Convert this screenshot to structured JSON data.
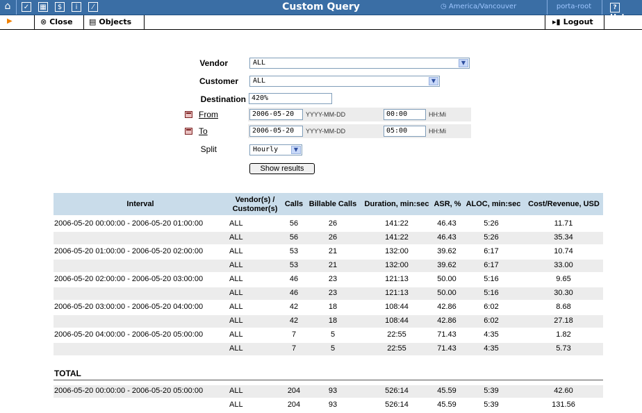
{
  "header": {
    "title": "Custom Query",
    "timezone": "America/Vancouver",
    "user": "porta-root",
    "help_label": "Help",
    "help_icon_glyph": "?",
    "icons": [
      "home-icon",
      "tasks-icon",
      "calculator-icon",
      "billing-icon",
      "info-icon",
      "stats-icon"
    ],
    "icon_glyphs": [
      "⌂",
      "✓",
      "▦",
      "$",
      "i",
      "⁄"
    ]
  },
  "toolbar": {
    "close_label": "Close",
    "objects_label": "Objects",
    "logout_label": "Logout"
  },
  "form": {
    "vendor_label": "Vendor",
    "vendor_value": "ALL",
    "customer_label": "Customer",
    "customer_value": "ALL",
    "destination_label": "Destination",
    "destination_value": "420%",
    "from_label": "From",
    "from_date": "2006-05-20",
    "from_time": "00:00",
    "to_label": "To",
    "to_date": "2006-05-20",
    "to_time": "05:00",
    "date_hint": "YYYY-MM-DD",
    "time_hint": "HH:Mi",
    "split_label": "Split",
    "split_value": "Hourly",
    "show_button": "Show results"
  },
  "table": {
    "headers": {
      "interval": "Interval",
      "vendor_customer_1": "Vendor(s) /",
      "vendor_customer_2": "Customer(s)",
      "calls": "Calls",
      "billable": "Billable Calls",
      "duration": "Duration, min:sec",
      "asr": "ASR, %",
      "aloc": "ALOC, min:sec",
      "cost": "Cost/Revenue, USD"
    },
    "rows": [
      {
        "interval": "2006-05-20 00:00:00 - 2006-05-20 01:00:00",
        "vc": "ALL",
        "calls": "56",
        "billable": "26",
        "duration": "141:22",
        "asr": "46.43",
        "aloc": "5:26",
        "cost": "11.71"
      },
      {
        "interval": "",
        "vc": "ALL",
        "calls": "56",
        "billable": "26",
        "duration": "141:22",
        "asr": "46.43",
        "aloc": "5:26",
        "cost": "35.34"
      },
      {
        "interval": "2006-05-20 01:00:00 - 2006-05-20 02:00:00",
        "vc": "ALL",
        "calls": "53",
        "billable": "21",
        "duration": "132:00",
        "asr": "39.62",
        "aloc": "6:17",
        "cost": "10.74"
      },
      {
        "interval": "",
        "vc": "ALL",
        "calls": "53",
        "billable": "21",
        "duration": "132:00",
        "asr": "39.62",
        "aloc": "6:17",
        "cost": "33.00"
      },
      {
        "interval": "2006-05-20 02:00:00 - 2006-05-20 03:00:00",
        "vc": "ALL",
        "calls": "46",
        "billable": "23",
        "duration": "121:13",
        "asr": "50.00",
        "aloc": "5:16",
        "cost": "9.65"
      },
      {
        "interval": "",
        "vc": "ALL",
        "calls": "46",
        "billable": "23",
        "duration": "121:13",
        "asr": "50.00",
        "aloc": "5:16",
        "cost": "30.30"
      },
      {
        "interval": "2006-05-20 03:00:00 - 2006-05-20 04:00:00",
        "vc": "ALL",
        "calls": "42",
        "billable": "18",
        "duration": "108:44",
        "asr": "42.86",
        "aloc": "6:02",
        "cost": "8.68"
      },
      {
        "interval": "",
        "vc": "ALL",
        "calls": "42",
        "billable": "18",
        "duration": "108:44",
        "asr": "42.86",
        "aloc": "6:02",
        "cost": "27.18"
      },
      {
        "interval": "2006-05-20 04:00:00 - 2006-05-20 05:00:00",
        "vc": "ALL",
        "calls": "7",
        "billable": "5",
        "duration": "22:55",
        "asr": "71.43",
        "aloc": "4:35",
        "cost": "1.82"
      },
      {
        "interval": "",
        "vc": "ALL",
        "calls": "7",
        "billable": "5",
        "duration": "22:55",
        "asr": "71.43",
        "aloc": "4:35",
        "cost": "5.73"
      }
    ],
    "total_label": "TOTAL",
    "totals": [
      {
        "interval": "2006-05-20 00:00:00 - 2006-05-20 05:00:00",
        "vc": "ALL",
        "calls": "204",
        "billable": "93",
        "duration": "526:14",
        "asr": "45.59",
        "aloc": "5:39",
        "cost": "42.60"
      },
      {
        "interval": "",
        "vc": "ALL",
        "calls": "204",
        "billable": "93",
        "duration": "526:14",
        "asr": "45.59",
        "aloc": "5:39",
        "cost": "131.56"
      }
    ]
  },
  "colors": {
    "header_bg": "#3a6ea5",
    "table_header_bg": "#c9dcea",
    "row_alt_bg": "#ececec"
  }
}
